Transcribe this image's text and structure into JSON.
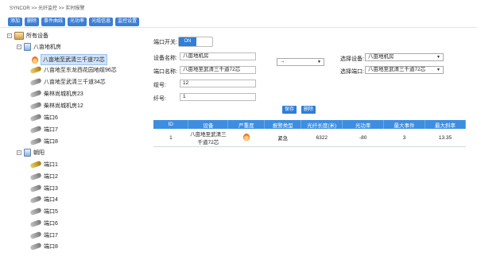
{
  "breadcrumb": "SYNCOR >> 光纤监控 >> 实时报警",
  "toolbar": [
    "添加",
    "删除",
    "事件曲线",
    "光功率",
    "光缆信息",
    "监控设置"
  ],
  "tree": {
    "root": "所有设备",
    "group1": {
      "label": "八亩地机房",
      "items": [
        "八亩地至武清三千道72芯",
        "八亩地至东龙西花园地缆96芯",
        "八亩地至武清三千道34芯",
        "柴林尚城机房23",
        "柴林尚城机房12",
        "端口6",
        "端口7",
        "端口8"
      ]
    },
    "group2": {
      "label": "朝阳",
      "items": [
        "端口1",
        "端口2",
        "端口3",
        "端口4",
        "端口5",
        "端口6",
        "端口7",
        "端口8"
      ]
    }
  },
  "form": {
    "port_switch_label": "端口开关:",
    "port_switch_value": "ON",
    "device_name_label": "设备名称:",
    "device_name_value": "八亩地机房",
    "port_name_label": "端口名称:",
    "port_name_value": "八亩地至武清三千道72芯",
    "cable_label": "缆号:",
    "cable_value": "12",
    "fiber_label": "纤号:",
    "fiber_value": "1",
    "direction_value": "→",
    "select_device_label": "选择设备:",
    "select_device_value": "八亩地机房",
    "select_port_label": "选择端口:",
    "select_port_value": "八亩地至武清三千道72芯",
    "save_label": "保存",
    "delete_label": "删除"
  },
  "table": {
    "headers": [
      "ID",
      "设备",
      "严重度",
      "报警类型",
      "光纤长度(米)",
      "光功率",
      "最大事件",
      "最大斜率"
    ],
    "rows": [
      {
        "id": "1",
        "device": "八亩地至武清三千道72芯",
        "type": "紧急",
        "length": "6322",
        "power": "-80",
        "max_event": "3",
        "max_slope": "13.35"
      }
    ]
  },
  "colors": {
    "accent": "#2f7ed8",
    "header": "#3d8ee0"
  }
}
